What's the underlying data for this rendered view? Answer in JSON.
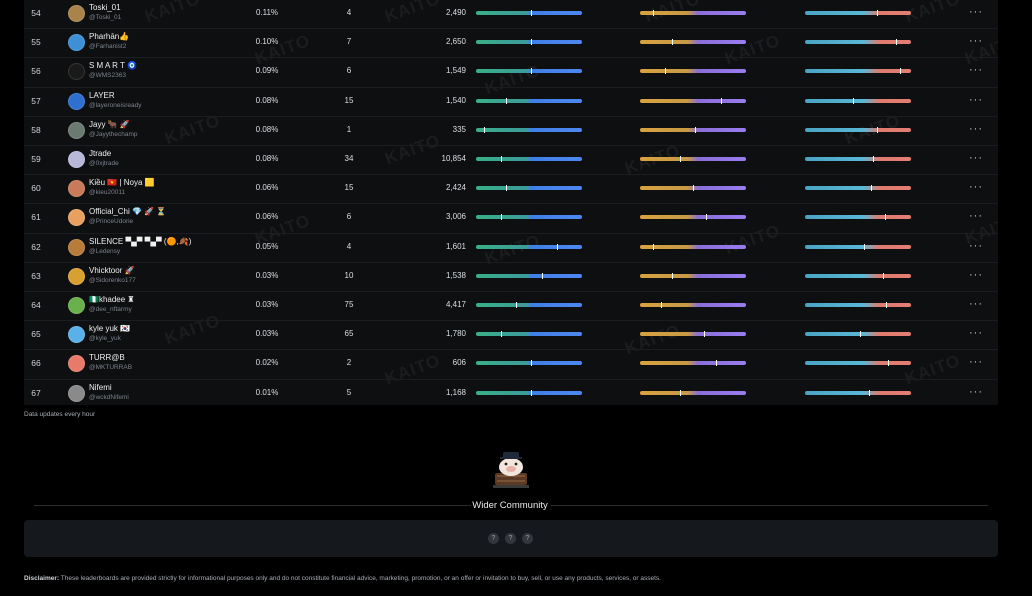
{
  "watermark_text": "KAITO",
  "rows": [
    {
      "rank": "54",
      "name": "Toski_01",
      "handle": "@Toski_01",
      "share": "0.11%",
      "count": "4",
      "value": "2,490",
      "avatar_color": "#a8834a",
      "m1": 0.52,
      "m2": 0.12,
      "m3": 0.68
    },
    {
      "rank": "55",
      "name": "Pharhān👍",
      "handle": "@Farhanist2",
      "share": "0.10%",
      "count": "7",
      "value": "2,650",
      "avatar_color": "#3d8fd6",
      "m1": 0.52,
      "m2": 0.3,
      "m3": 0.86
    },
    {
      "rank": "56",
      "name": "S M A R T 🧿",
      "handle": "@WMS2363",
      "share": "0.09%",
      "count": "6",
      "value": "1,549",
      "avatar_color": "#1a1a1a",
      "m1": 0.52,
      "m2": 0.24,
      "m3": 0.9
    },
    {
      "rank": "57",
      "name": "LAYER",
      "handle": "@layeroneisready",
      "share": "0.08%",
      "count": "15",
      "value": "1,540",
      "avatar_color": "#2e6fd0",
      "m1": 0.28,
      "m2": 0.76,
      "m3": 0.45
    },
    {
      "rank": "58",
      "name": "Jayy 🐂 🚀",
      "handle": "@Jayythechamp",
      "share": "0.08%",
      "count": "1",
      "value": "335",
      "avatar_color": "#6a7a70",
      "m1": 0.08,
      "m2": 0.52,
      "m3": 0.68
    },
    {
      "rank": "59",
      "name": "Jtrade",
      "handle": "@0xjtrade",
      "share": "0.08%",
      "count": "34",
      "value": "10,854",
      "avatar_color": "#b8b8d8",
      "m1": 0.24,
      "m2": 0.38,
      "m3": 0.64
    },
    {
      "rank": "60",
      "name": "Kiều 🇻🇳 | Noya 🟨",
      "handle": "@kieu20011",
      "share": "0.06%",
      "count": "15",
      "value": "2,424",
      "avatar_color": "#c87a5a",
      "m1": 0.28,
      "m2": 0.5,
      "m3": 0.62
    },
    {
      "rank": "61",
      "name": "Official_Chi 💎 🚀 ⏳",
      "handle": "@PrinceUdorie",
      "share": "0.06%",
      "count": "6",
      "value": "3,006",
      "avatar_color": "#e8a060",
      "m1": 0.24,
      "m2": 0.62,
      "m3": 0.75
    },
    {
      "rank": "62",
      "name": "SILENCE ▀▄▀ ▀▄▀ (🟠,🍂)",
      "handle": "@Ledensy",
      "share": "0.05%",
      "count": "4",
      "value": "1,601",
      "avatar_color": "#b87c3a",
      "m1": 0.76,
      "m2": 0.12,
      "m3": 0.56
    },
    {
      "rank": "63",
      "name": "Vhicktoor 🚀",
      "handle": "@Sidorenko177",
      "share": "0.03%",
      "count": "10",
      "value": "1,538",
      "avatar_color": "#d8a030",
      "m1": 0.62,
      "m2": 0.3,
      "m3": 0.74
    },
    {
      "rank": "64",
      "name": "🇳🇬khadee ♜",
      "handle": "@dee_nftarmy",
      "share": "0.03%",
      "count": "75",
      "value": "4,417",
      "avatar_color": "#6ab04c",
      "m1": 0.38,
      "m2": 0.2,
      "m3": 0.76
    },
    {
      "rank": "65",
      "name": "kyle yuk 🇰🇷",
      "handle": "@kyle_yuk",
      "share": "0.03%",
      "count": "65",
      "value": "1,780",
      "avatar_color": "#5ab0e8",
      "m1": 0.24,
      "m2": 0.6,
      "m3": 0.52
    },
    {
      "rank": "66",
      "name": "TURR@B",
      "handle": "@MKTURRAB",
      "share": "0.02%",
      "count": "2",
      "value": "606",
      "avatar_color": "#e87a6a",
      "m1": 0.52,
      "m2": 0.72,
      "m3": 0.78
    },
    {
      "rank": "67",
      "name": "Nifemi",
      "handle": "@wckdNifemi",
      "share": "0.01%",
      "count": "5",
      "value": "1,168",
      "avatar_color": "#8a8a8a",
      "m1": 0.52,
      "m2": 0.38,
      "m3": 0.6
    }
  ],
  "more_label": "···",
  "footnote": "Data updates every hour",
  "section_title": "Wider Community",
  "community_dots": [
    "?",
    "?",
    "?"
  ],
  "disclaimer_label": "Disclaimer:",
  "disclaimer_text": "These leaderboards are provided strictly for informational purposes only and do not constitute financial advice, marketing, promotion, or an offer or invitation to buy, sell, or use any products, services, or assets."
}
